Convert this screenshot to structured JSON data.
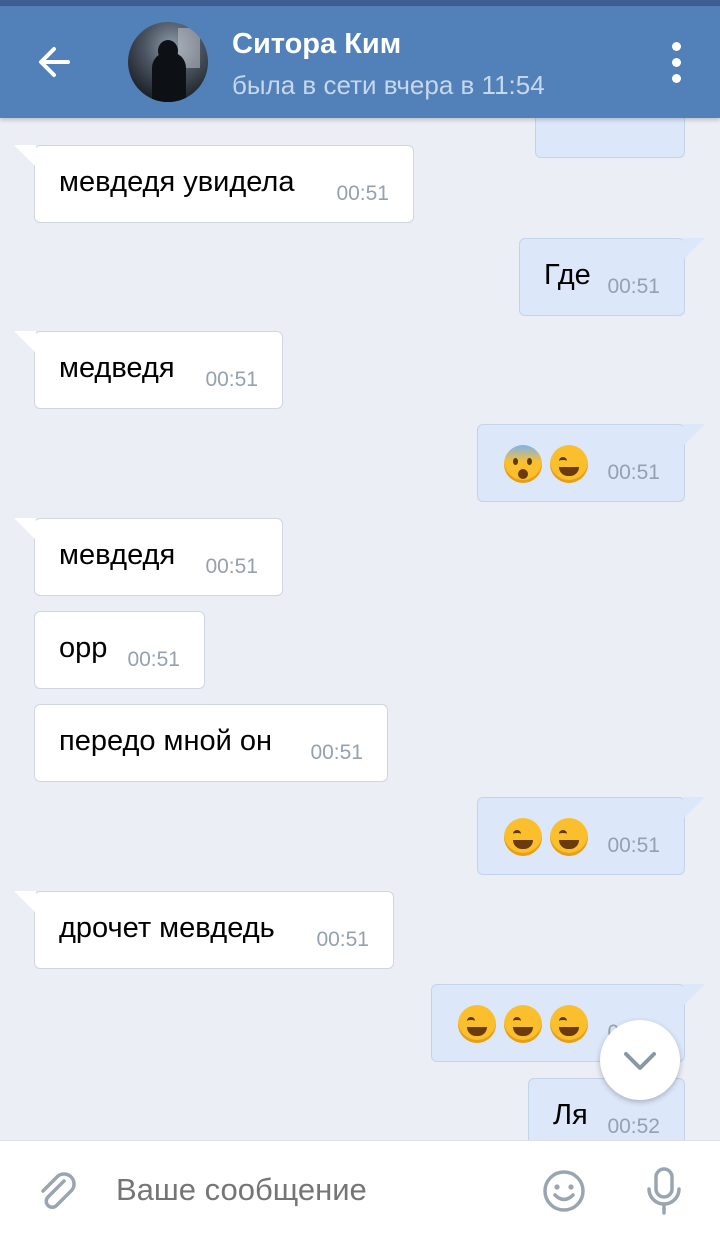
{
  "header": {
    "title": "Ситора Ким",
    "subtitle": "была в сети вчера в 11:54"
  },
  "messages": [
    {
      "dir": "in",
      "text": "мевдедя увидела",
      "time": "00:51"
    },
    {
      "dir": "out",
      "text": "Где",
      "time": "00:51"
    },
    {
      "dir": "in",
      "text": "медведя",
      "time": "00:51"
    },
    {
      "dir": "out",
      "emoji": [
        "face-with-open-mouth-cold-sweat",
        "face-with-tears-of-joy"
      ],
      "time": "00:51"
    },
    {
      "dir": "in",
      "text": "мевдедя",
      "time": "00:51"
    },
    {
      "dir": "in",
      "text": "орр",
      "time": "00:51"
    },
    {
      "dir": "in",
      "text": "передо мной он",
      "time": "00:51"
    },
    {
      "dir": "out",
      "emoji": [
        "face-with-tears-of-joy",
        "face-with-tears-of-joy"
      ],
      "time": "00:51"
    },
    {
      "dir": "in",
      "text": "дрочет мевдедь",
      "time": "00:51"
    },
    {
      "dir": "out",
      "emoji": [
        "face-with-tears-of-joy",
        "face-with-tears-of-joy",
        "face-with-tears-of-joy"
      ],
      "time": "00:51"
    },
    {
      "dir": "out",
      "text": "Ля",
      "time": "00:52"
    }
  ],
  "composer": {
    "placeholder": "Ваше сообщение"
  },
  "colors": {
    "header": "#5181b8",
    "background": "#ebeef5",
    "outgoing_bubble": "#dce8fa",
    "incoming_bubble": "#ffffff"
  }
}
